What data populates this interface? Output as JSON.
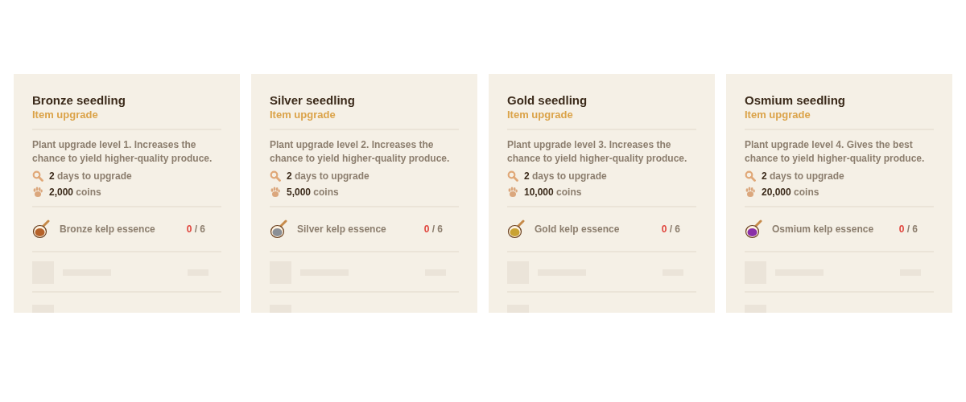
{
  "cards": [
    {
      "title": "Bronze seedling",
      "subtitle": "Item upgrade",
      "description": "Plant upgrade level 1. Increases the chance to yield higher-quality produce.",
      "time": "**2** days to upgrade",
      "cost": "**2,000** coins",
      "ingredient": {
        "name": "Bronze kelp essence",
        "color": "#b5622a",
        "owned": "0",
        "required": "/ 6"
      }
    },
    {
      "title": "Silver seedling",
      "subtitle": "Item upgrade",
      "description": "Plant upgrade level 2. Increases the chance to yield higher-quality produce.",
      "time": "**2** days to upgrade",
      "cost": "**5,000** coins",
      "ingredient": {
        "name": "Silver kelp essence",
        "color": "#8a8f96",
        "owned": "0",
        "required": "/ 6"
      }
    },
    {
      "title": "Gold seedling",
      "subtitle": "Item upgrade",
      "description": "Plant upgrade level 3. Increases the chance to yield higher-quality produce.",
      "time": "**2** days to upgrade",
      "cost": "**10,000** coins",
      "ingredient": {
        "name": "Gold kelp essence",
        "color": "#c9a233",
        "owned": "0",
        "required": "/ 6"
      }
    },
    {
      "title": "Osmium seedling",
      "subtitle": "Item upgrade",
      "description": "Plant upgrade level 4. Gives the best chance to yield higher-quality produce.",
      "time": "**2** days to upgrade",
      "cost": "**20,000** coins",
      "ingredient": {
        "name": "Osmium kelp essence",
        "color": "#8a2fa8",
        "owned": "0",
        "required": "/ 6"
      }
    }
  ]
}
